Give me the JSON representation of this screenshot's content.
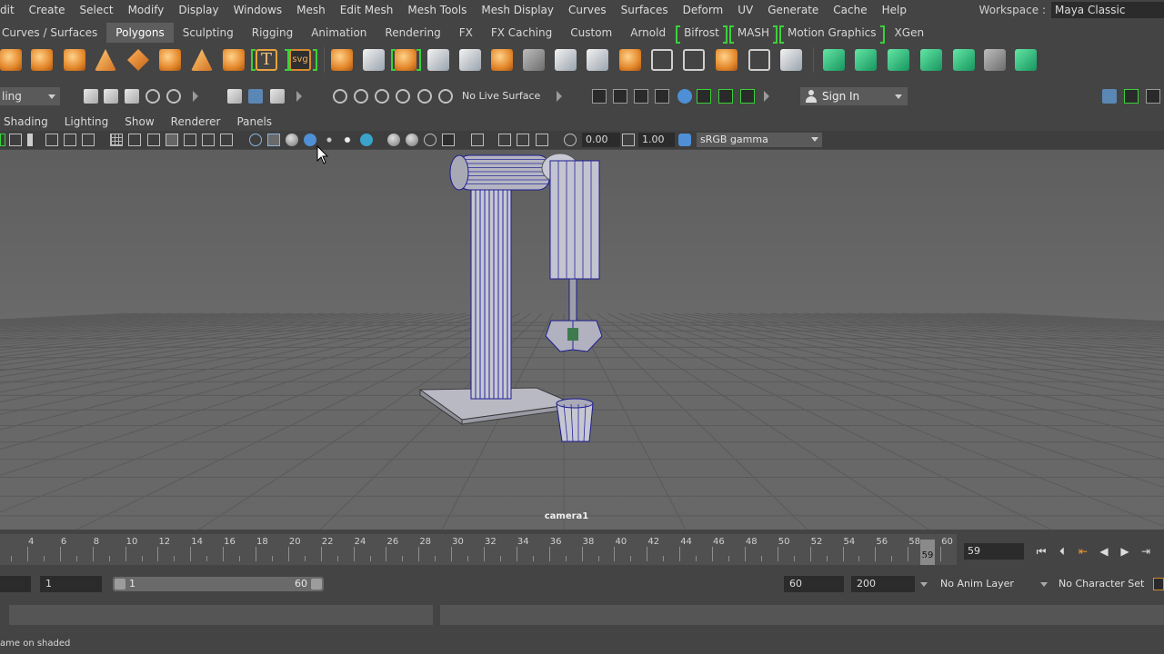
{
  "menubar": {
    "items": [
      "dit",
      "Create",
      "Select",
      "Modify",
      "Display",
      "Windows",
      "Mesh",
      "Edit Mesh",
      "Mesh Tools",
      "Mesh Display",
      "Curves",
      "Surfaces",
      "Deform",
      "UV",
      "Generate",
      "Cache",
      "Help"
    ],
    "workspace_label": "Workspace :",
    "workspace_value": "Maya Classic"
  },
  "shelf_tabs": [
    "Curves / Surfaces",
    "Polygons",
    "Sculpting",
    "Rigging",
    "Animation",
    "Rendering",
    "FX",
    "FX Caching",
    "Custom",
    "Arnold",
    "Bifrost",
    "MASH",
    "Motion Graphics",
    "XGen"
  ],
  "shelf_active_tab": "Polygons",
  "shelf_icons": [
    "sphere-icon",
    "cube-icon",
    "cylinder-icon",
    "cone-icon",
    "plane-icon",
    "torus-icon",
    "pyramid-icon",
    "pipe-icon",
    "type-icon",
    "svg-icon",
    "combine-icon",
    "separate-icon",
    "extrude-icon",
    "bridge-icon",
    "smooth-icon",
    "bevel-icon",
    "multi-cut-icon",
    "target-weld-icon",
    "planar-uv-icon",
    "automatic-uv-icon",
    "uv-editor-icon",
    "bool-union-icon",
    "bool-difference-icon",
    "bool-intersection-icon",
    "mirror-icon",
    "fill-hole-icon",
    "merge-icon",
    "triangulate-icon",
    "quadrangulate-icon"
  ],
  "status_line": {
    "mode": "ling",
    "live_surface": "No Live Surface",
    "sign_in": "Sign In"
  },
  "panel_menu": [
    "Shading",
    "Lighting",
    "Show",
    "Renderer",
    "Panels"
  ],
  "panel_toolbar": {
    "exposure": "0.00",
    "gamma_value": "1.00",
    "color_space": "sRGB gamma"
  },
  "viewport": {
    "camera_label": "camera1"
  },
  "time_slider": {
    "ticks": [
      4,
      6,
      8,
      10,
      12,
      14,
      16,
      18,
      20,
      22,
      24,
      26,
      28,
      30,
      32,
      34,
      36,
      38,
      40,
      42,
      44,
      46,
      48,
      50,
      52,
      54,
      56,
      58,
      60
    ],
    "current_frame_marker": "59",
    "current_frame": "59"
  },
  "range_slider": {
    "start": "1",
    "range_start": "1",
    "range_end": "60",
    "end": "60",
    "anim_end": "200",
    "anim_layer": "No Anim Layer",
    "character_set": "No Character Set"
  },
  "help_line": {
    "text": "ame on shaded"
  }
}
